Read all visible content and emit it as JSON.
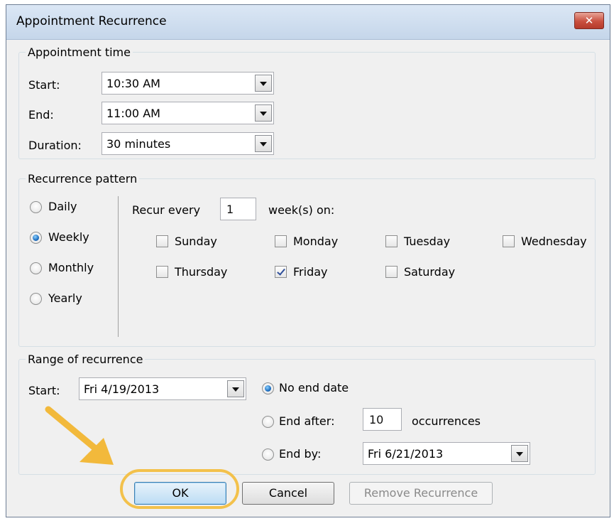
{
  "dialog": {
    "title": "Appointment Recurrence",
    "close_glyph": "✕"
  },
  "appointment_time": {
    "legend": "Appointment time",
    "start": {
      "label": "Start:",
      "value": "10:30 AM"
    },
    "end": {
      "label": "End:",
      "value": "11:00 AM"
    },
    "duration": {
      "label": "Duration:",
      "value": "30 minutes"
    }
  },
  "recurrence_pattern": {
    "legend": "Recurrence pattern",
    "frequencies": [
      {
        "label": "Daily",
        "selected": false
      },
      {
        "label": "Weekly",
        "selected": true
      },
      {
        "label": "Monthly",
        "selected": false
      },
      {
        "label": "Yearly",
        "selected": false
      }
    ],
    "recur_every_label": "Recur every",
    "recur_every_value": "1",
    "weeks_on_label": "week(s) on:",
    "days": [
      {
        "label": "Sunday",
        "checked": false
      },
      {
        "label": "Monday",
        "checked": false
      },
      {
        "label": "Tuesday",
        "checked": false
      },
      {
        "label": "Wednesday",
        "checked": false
      },
      {
        "label": "Thursday",
        "checked": false
      },
      {
        "label": "Friday",
        "checked": true
      },
      {
        "label": "Saturday",
        "checked": false
      }
    ]
  },
  "range": {
    "legend": "Range of recurrence",
    "start_label": "Start:",
    "start_value": "Fri 4/19/2013",
    "no_end_date_label": "No end date",
    "end_after_label": "End after:",
    "end_after_value": "10",
    "occurrences_label": "occurrences",
    "end_by_label": "End by:",
    "end_by_value": "Fri 6/21/2013",
    "selected_option": "No end date"
  },
  "buttons": {
    "ok": "OK",
    "cancel": "Cancel",
    "remove": "Remove Recurrence"
  },
  "colors": {
    "highlight": "#f3c14b",
    "arrow": "#f2b93b",
    "title_bar": "#c9d9ec",
    "close": "#c9503f"
  }
}
